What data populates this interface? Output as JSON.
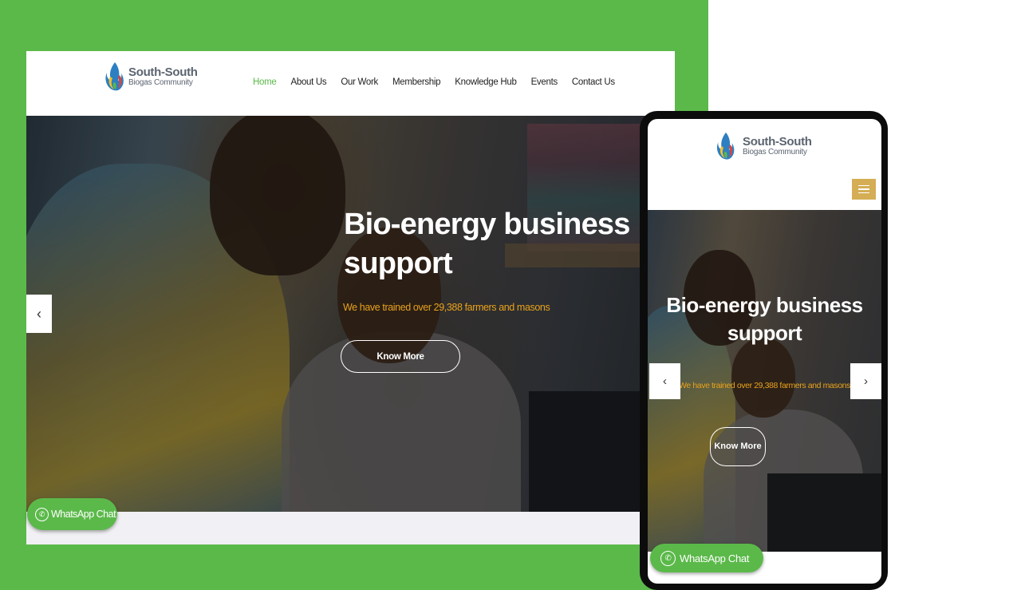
{
  "brand": {
    "name": "South-South",
    "tagline": "Biogas Community",
    "colors": {
      "green": "#5bb94a",
      "accent_orange": "#e8a21b",
      "menu_gold": "#d4ad55"
    }
  },
  "nav": {
    "items": [
      {
        "label": "Home",
        "active": true
      },
      {
        "label": "About Us"
      },
      {
        "label": "Our Work"
      },
      {
        "label": "Membership"
      },
      {
        "label": "Knowledge Hub"
      },
      {
        "label": "Events"
      },
      {
        "label": "Contact Us"
      }
    ]
  },
  "hero": {
    "title": "Bio-energy business support",
    "subtitle": "We have trained over 29,388 farmers and masons",
    "cta_label": "Know More",
    "prev_icon": "chevron-left-icon",
    "next_icon": "chevron-right-icon"
  },
  "whatsapp": {
    "label": "WhatsApp Chat",
    "icon": "whatsapp-icon"
  },
  "mobile": {
    "menu_icon": "hamburger-menu-icon"
  }
}
